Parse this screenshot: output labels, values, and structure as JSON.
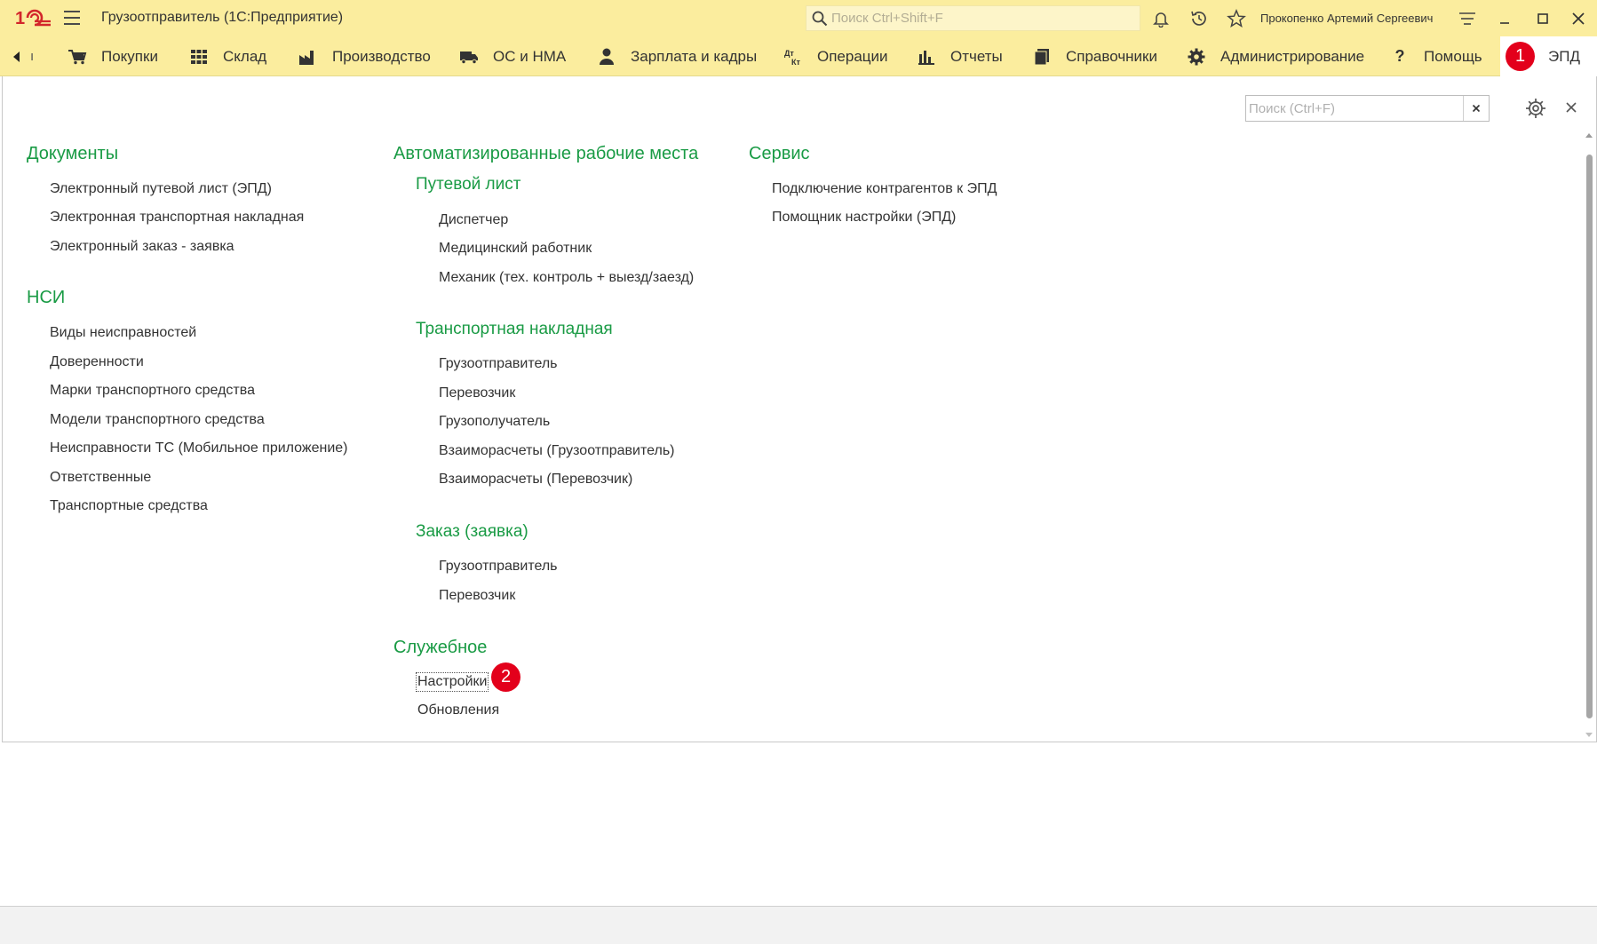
{
  "titlebar": {
    "app_title": "Грузоотправитель  (1С:Предприятие)",
    "search_placeholder": "Поиск Ctrl+Shift+F",
    "user_name": "Прокопенко Артемий Сергеевич"
  },
  "sections": [
    {
      "label": "Покупки",
      "icon": "cart-icon"
    },
    {
      "label": "Склад",
      "icon": "warehouse-icon"
    },
    {
      "label": "Производство",
      "icon": "factory-icon"
    },
    {
      "label": "ОС и НМА",
      "icon": "truck-icon"
    },
    {
      "label": "Зарплата и кадры",
      "icon": "person-icon"
    },
    {
      "label": "Операции",
      "icon": "dt-kt-icon"
    },
    {
      "label": "Отчеты",
      "icon": "bar-chart-icon"
    },
    {
      "label": "Справочники",
      "icon": "books-icon"
    },
    {
      "label": "Администрирование",
      "icon": "gear-icon"
    },
    {
      "label": "Помощь",
      "icon": "question-icon"
    }
  ],
  "active_section": {
    "label": "ЭПД"
  },
  "markers": {
    "m1": "1",
    "m2": "2"
  },
  "panel": {
    "search_placeholder": "Поиск (Ctrl+F)"
  },
  "groups": {
    "documents": {
      "title": "Документы",
      "items": [
        "Электронный путевой лист  (ЭПД)",
        "Электронная транспортная накладная",
        "Электронный заказ - заявка"
      ]
    },
    "nsi": {
      "title": "НСИ",
      "items": [
        "Виды неисправностей",
        "Доверенности",
        "Марки транспортного средства",
        "Модели транспортного средства",
        "Неисправности ТС (Мобильное приложение)",
        "Ответственные",
        "Транспортные средства"
      ]
    },
    "arm": {
      "title": "Автоматизированные рабочие места",
      "waybill": {
        "title": "Путевой лист",
        "items": [
          "Диспетчер",
          "Медицинский работник",
          "Механик (тех. контроль + выезд/заезд)"
        ]
      },
      "transport": {
        "title": "Транспортная накладная",
        "items": [
          "Грузоотправитель",
          "Перевозчик",
          "Грузополучатель",
          "Взаиморасчеты (Грузоотправитель)",
          "Взаиморасчеты (Перевозчик)"
        ]
      },
      "order": {
        "title": "Заказ (заявка)",
        "items": [
          "Грузоотправитель",
          "Перевозчик"
        ]
      }
    },
    "service_section": {
      "title": "Служебное",
      "items": [
        "Настройки",
        "Обновления"
      ]
    },
    "service": {
      "title": "Сервис",
      "items": [
        "Подключение контрагентов к ЭПД",
        "Помощник настройки (ЭПД)"
      ]
    }
  },
  "colors": {
    "accent_bar": "#fbed9e",
    "heading_green": "#1a9b45",
    "marker_red": "#e3001b"
  }
}
